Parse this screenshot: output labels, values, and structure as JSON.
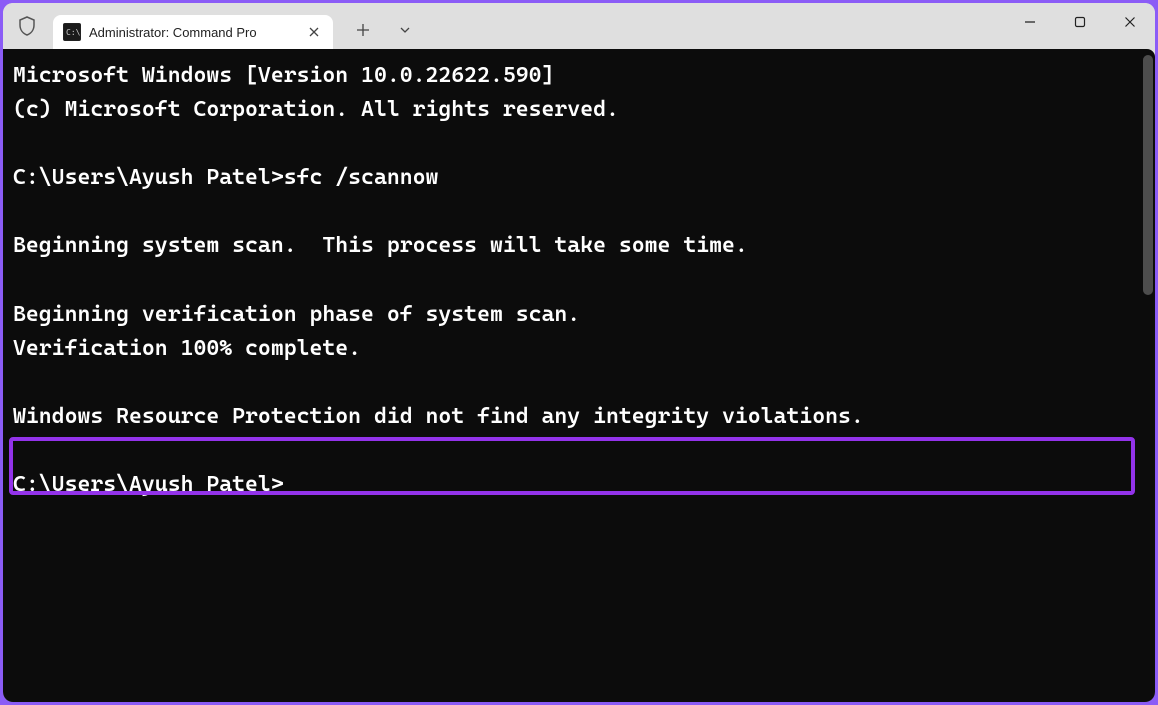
{
  "window": {
    "tab_title": "Administrator: Command Pro",
    "tab_icon_text": "C:\\"
  },
  "terminal": {
    "lines": [
      "Microsoft Windows [Version 10.0.22622.590]",
      "(c) Microsoft Corporation. All rights reserved.",
      "",
      "C:\\Users\\Ayush Patel>sfc /scannow",
      "",
      "Beginning system scan.  This process will take some time.",
      "",
      "Beginning verification phase of system scan.",
      "Verification 100% complete.",
      "",
      "Windows Resource Protection did not find any integrity violations.",
      "",
      "C:\\Users\\Ayush Patel>"
    ],
    "highlighted_line_index": 10
  }
}
